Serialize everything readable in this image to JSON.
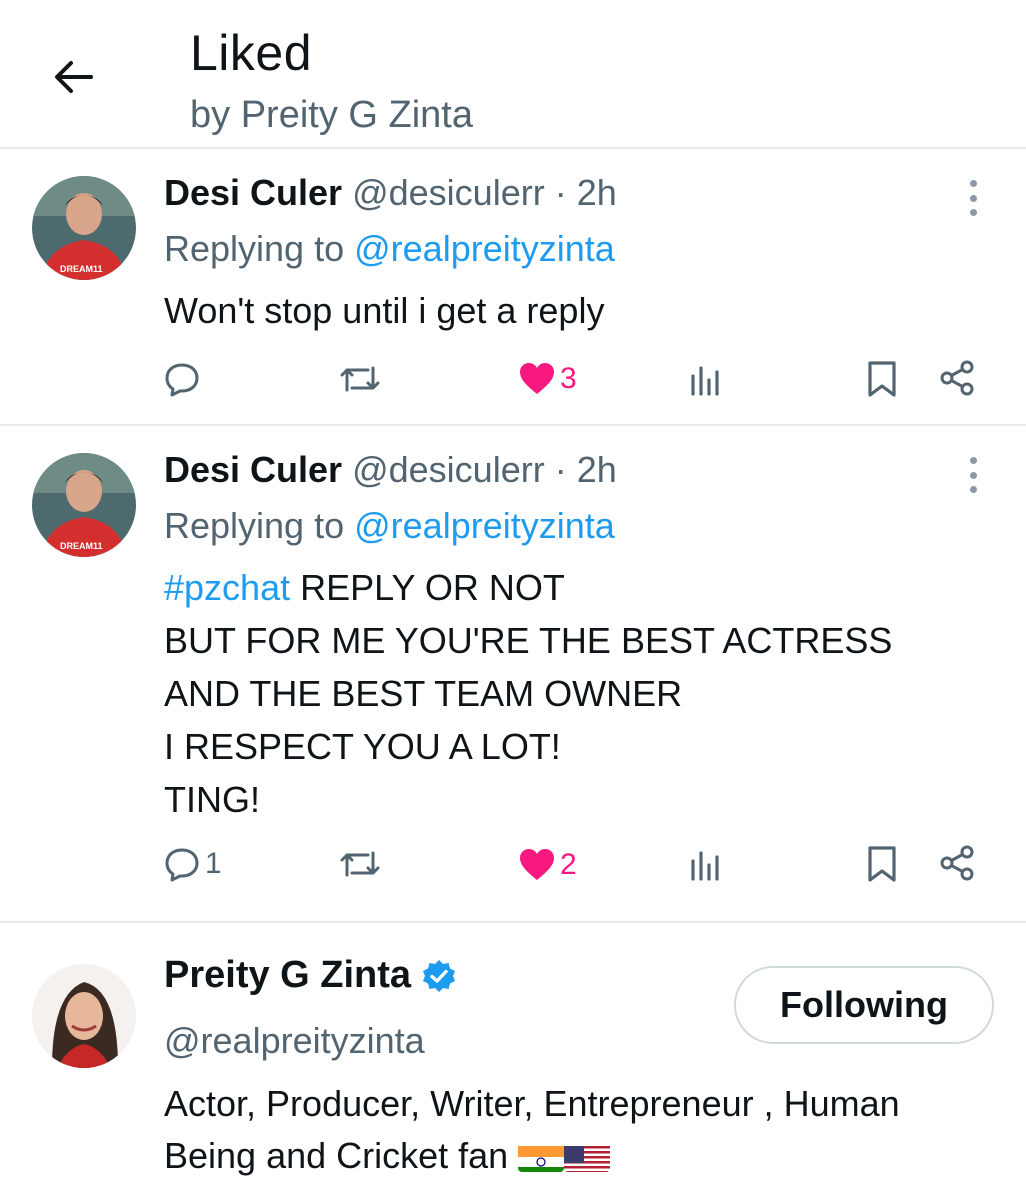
{
  "header": {
    "title": "Liked",
    "subtitle": "by Preity G Zinta"
  },
  "tweets": [
    {
      "name": "Desi Culer",
      "handle": "@desiculerr",
      "separator": "·",
      "time": "2h",
      "replying_prefix": "Replying to",
      "replying_to": "@realpreityzinta",
      "text": "Won't stop until i get a reply",
      "reply_count": "",
      "like_count": "3",
      "liked": true
    },
    {
      "name": "Desi Culer",
      "handle": "@desiculerr",
      "separator": "·",
      "time": "2h",
      "replying_prefix": "Replying to",
      "replying_to": "@realpreityzinta",
      "hashtag": "#pzchat",
      "line1_rest": "REPLY OR NOT",
      "lines": [
        "BUT FOR ME YOU'RE THE BEST ACTRESS",
        "AND THE BEST TEAM OWNER",
        "I RESPECT YOU A LOT!",
        "TING!"
      ],
      "reply_count": "1",
      "like_count": "2",
      "liked": true
    }
  ],
  "profile": {
    "name": "Preity G Zinta",
    "verified": true,
    "handle": "@realpreityzinta",
    "follow_button_label": "Following",
    "bio": "Actor, Producer, Writer, Entrepreneur , Human Being and Cricket fan",
    "bio_flags": [
      "india-flag",
      "usa-flag"
    ]
  },
  "colors": {
    "link": "#1d9bf0",
    "like": "#f91880",
    "secondary_text": "#536471",
    "divider": "#e7e9ea"
  },
  "icons": [
    "back-arrow-icon",
    "more-vertical-icon",
    "reply-icon",
    "retweet-icon",
    "heart-icon",
    "views-icon",
    "bookmark-icon",
    "share-icon",
    "verified-badge-icon"
  ]
}
